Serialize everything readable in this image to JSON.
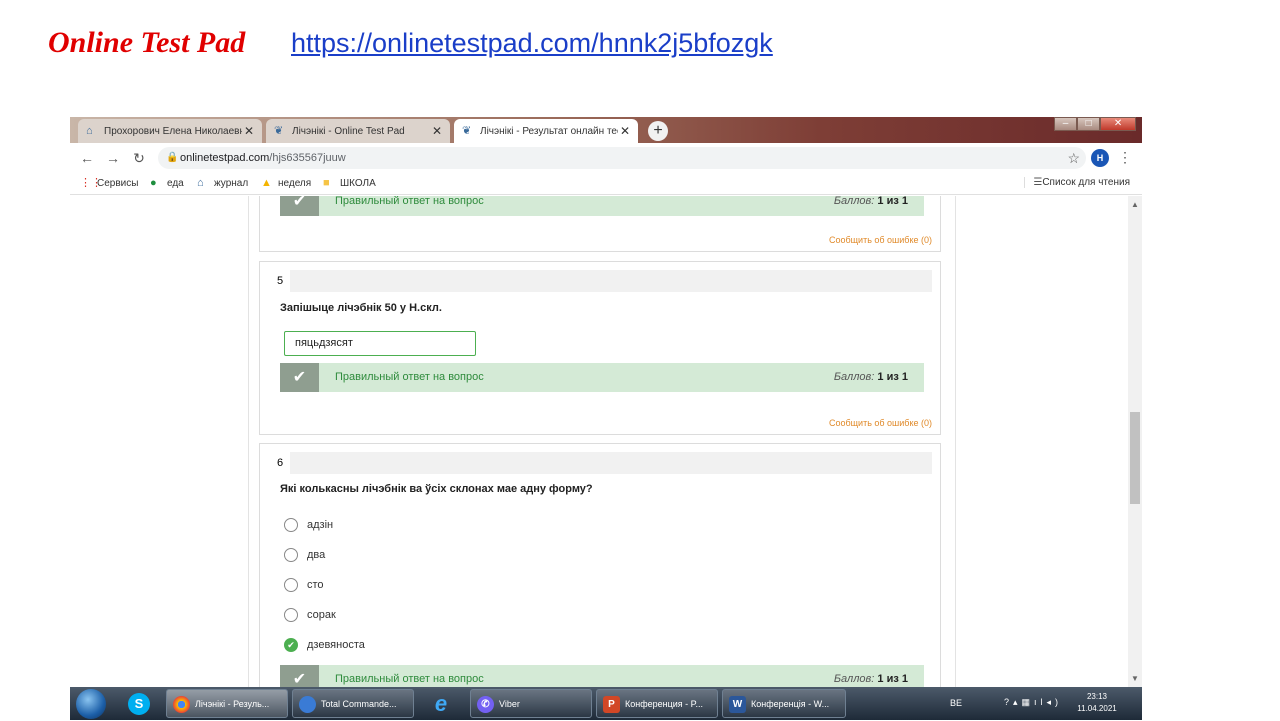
{
  "slide": {
    "title": "Online Test Pad",
    "link": "https://onlinetestpad.com/hnnk2j5bfozgk"
  },
  "browser": {
    "tabs": [
      {
        "label": "Прохорович Елена Николаевна",
        "icon": "home-icon"
      },
      {
        "label": "Лічэнікі - Online Test Pad",
        "icon": "testpad-icon"
      },
      {
        "label": "Лічэнікі - Результат онлайн тест",
        "icon": "testpad-icon"
      }
    ],
    "url_host": "onlinetestpad.com",
    "url_path": "/hjs635567juuw",
    "avatar_letter": "Н",
    "bookmarks": [
      "Сервисы",
      "еда",
      "журнал",
      "неделя",
      "ШКОЛА"
    ],
    "reading_list": "Список для чтения"
  },
  "page": {
    "prev_card": {
      "result_text": "Правильный ответ на вопрос",
      "score_label": "Баллов:",
      "score_value": "1 из 1",
      "report": "Сообщить об ошибке (0)"
    },
    "q5": {
      "number": "5",
      "text": "Запішыце лічэбнік 50 у Н.скл.",
      "answer": "пяцьдзясят",
      "result_text": "Правильный ответ на вопрос",
      "score_label": "Баллов:",
      "score_value": "1 из 1",
      "report": "Сообщить об ошибке (0)"
    },
    "q6": {
      "number": "6",
      "text": "Які колькасны лічэбнік ва ўсіх склонах мае адну форму?",
      "options": [
        {
          "label": "адзін",
          "selected": false
        },
        {
          "label": "два",
          "selected": false
        },
        {
          "label": "сто",
          "selected": false
        },
        {
          "label": "сорак",
          "selected": false
        },
        {
          "label": "дзевяноста",
          "selected": true
        }
      ],
      "result_text": "Правильный ответ на вопрос",
      "score_label": "Баллов:",
      "score_value": "1 из 1"
    }
  },
  "taskbar": {
    "items": [
      {
        "label": "Лічэнікі - Резуль...",
        "icon": "chrome-icon"
      },
      {
        "label": "Total Commande...",
        "icon": "total-commander-icon"
      },
      {
        "label": "Viber",
        "icon": "viber-icon"
      },
      {
        "label": "Конференция - P...",
        "icon": "powerpoint-icon"
      },
      {
        "label": "Конференція - W...",
        "icon": "word-icon"
      }
    ],
    "lang": "BE",
    "time": "23:13",
    "date": "11.04.2021"
  },
  "colors": {
    "title_red": "#e00000",
    "link_blue": "#1a3ec8",
    "correct_green": "#4caf50",
    "result_bg": "#d4ead6",
    "report_orange": "#e08a2a"
  }
}
